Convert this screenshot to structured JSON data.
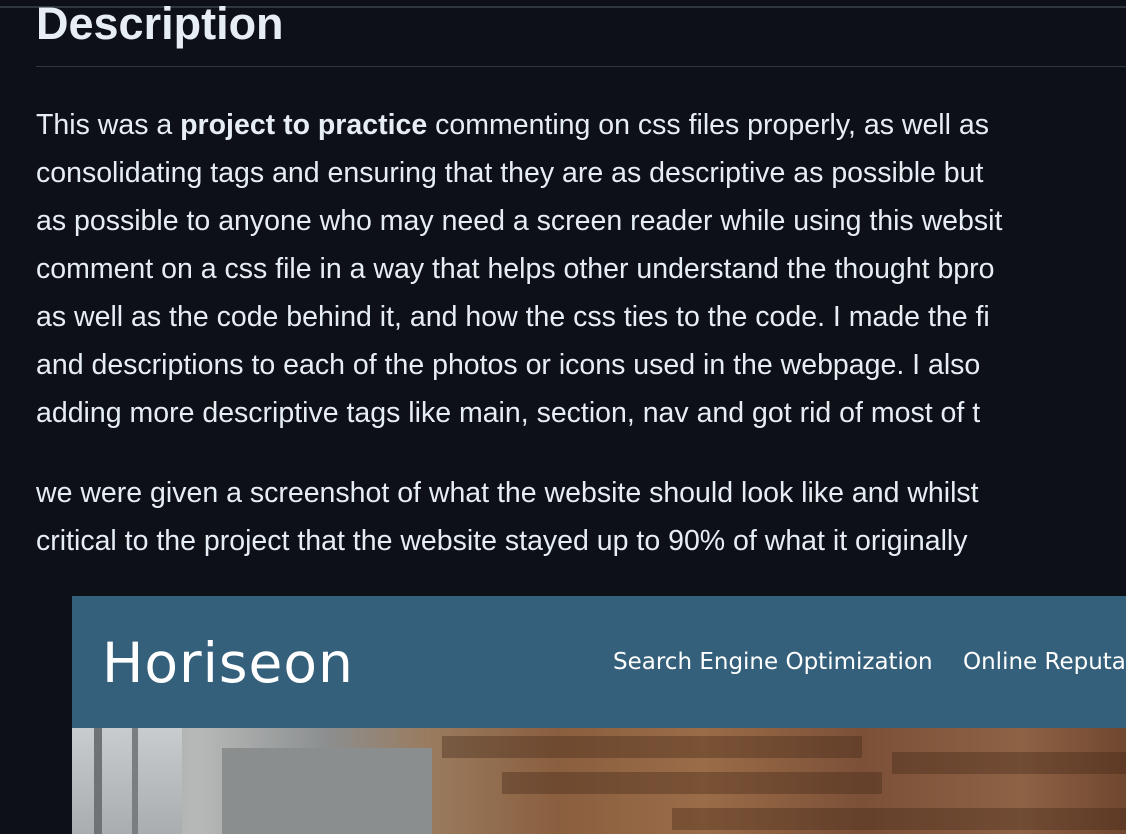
{
  "section": {
    "heading": "Description"
  },
  "paragraph_1": {
    "line_1_prefix": "This was a ",
    "line_1_bold": "project to practice",
    "line_1_suffix": " commenting on css files properly, as well as",
    "line_2": "consolidating tags and ensuring that they are as descriptive as possible but",
    "line_3": "as possible to anyone who may need a screen reader while using this websit",
    "line_4": "comment on a css file in a way that helps other understand the thought bpro",
    "line_5": "as well as the code behind it, and how the css ties to the code. I made the fi",
    "line_6": "and descriptions to each of the photos or icons used in the webpage. I also",
    "line_7": "adding more descriptive tags like main, section, nav and got rid of most of t"
  },
  "paragraph_2": {
    "line_1": "we were given a screenshot of what the website should look like and whilst",
    "line_2": "critical to the project that the website stayed up to 90% of what it originally"
  },
  "screenshot": {
    "logo": "Horiseon",
    "nav": [
      "Search Engine Optimization",
      "Online Reputa"
    ],
    "colors": {
      "header_background": "#35607c",
      "page_background": "#0d1117",
      "text": "#e6edf3"
    }
  }
}
